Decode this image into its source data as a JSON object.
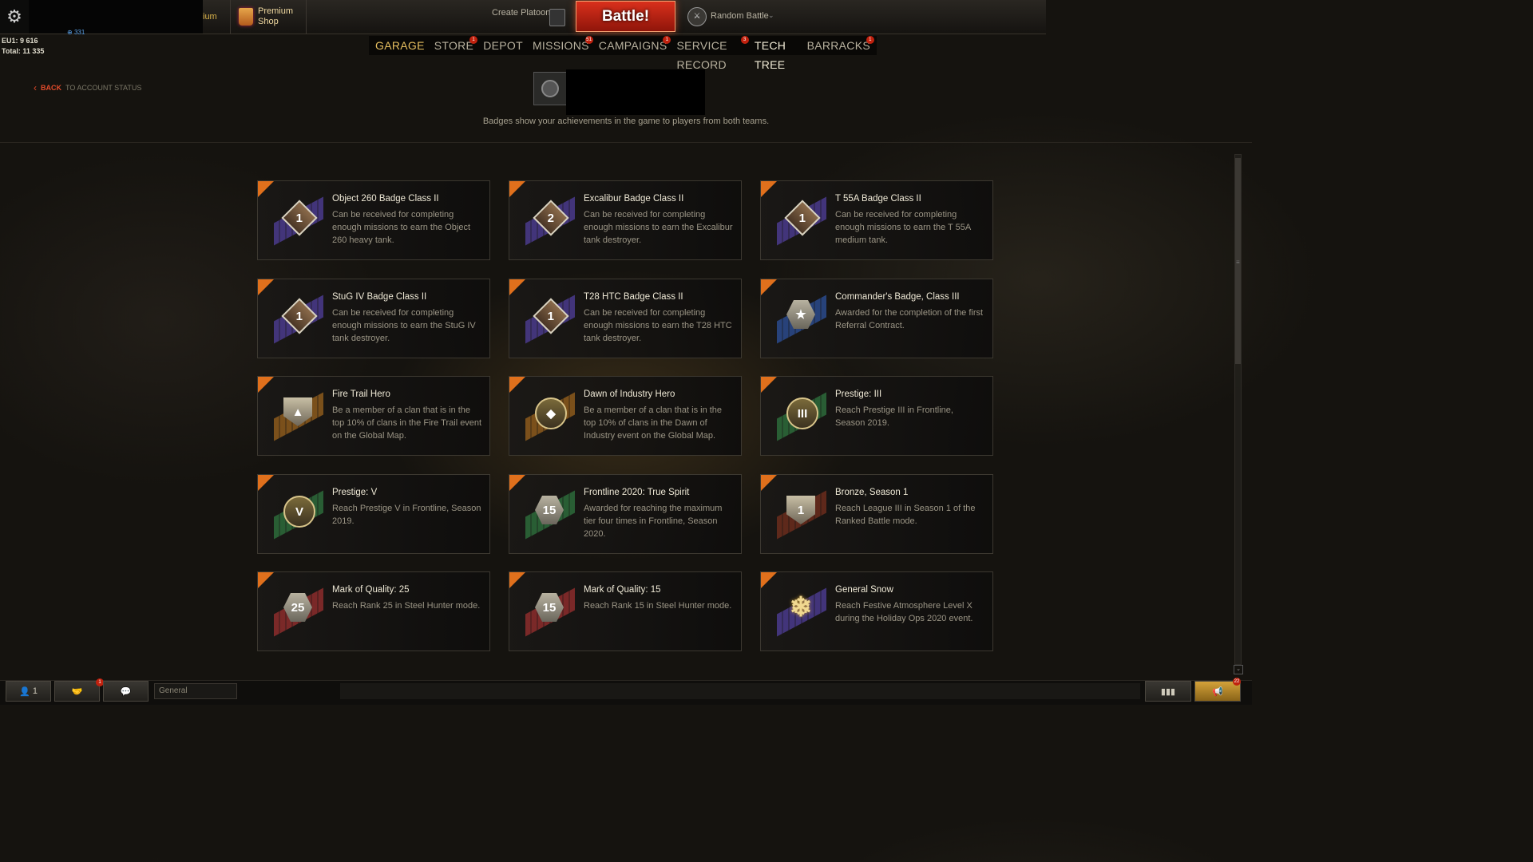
{
  "topbar": {
    "premium_fragment": "ium",
    "premium_shop_label_1": "Premium",
    "premium_shop_label_2": "Shop",
    "create_platoon": "Create Platoon",
    "battle_button": "Battle!",
    "battle_mode": "Random Battle"
  },
  "stats": {
    "line1": "EU1: 9 616",
    "line2": "Total: 11 335",
    "mini_value": "331"
  },
  "nav": [
    {
      "label": "GARAGE",
      "badge": ""
    },
    {
      "label": "STORE",
      "badge": "1"
    },
    {
      "label": "DEPOT",
      "badge": ""
    },
    {
      "label": "MISSIONS",
      "badge": "51"
    },
    {
      "label": "CAMPAIGNS",
      "badge": "1"
    },
    {
      "label": "SERVICE RECORD",
      "badge": "3"
    },
    {
      "label": "TECH TREE",
      "badge": ""
    },
    {
      "label": "BARRACKS",
      "badge": "1"
    }
  ],
  "back": {
    "back_label": "BACK",
    "target_label": "TO ACCOUNT STATUS"
  },
  "header": {
    "subtitle": "Badges show your achievements in the game to players from both teams."
  },
  "colors": {
    "accent_orange": "#e0701c",
    "battle_red": "#c3200f",
    "nav_active": "#e8c060"
  },
  "badges": [
    {
      "title": "Object 260 Badge Class II",
      "desc": "Can be received for completing enough missions to earn the Object 260 heavy tank.",
      "icon": "rank-1-diamond-icon",
      "glyph": "1",
      "stripe": "#4a3a8c"
    },
    {
      "title": "Excalibur Badge Class II",
      "desc": "Can be received for completing enough missions to earn the Excalibur tank destroyer.",
      "icon": "rank-2-diamond-icon",
      "glyph": "2",
      "stripe": "#4a3a8c"
    },
    {
      "title": "T 55A Badge Class II",
      "desc": "Can be received for completing enough missions to earn the T 55A medium tank.",
      "icon": "rank-1-diamond-icon",
      "glyph": "1",
      "stripe": "#4a3a8c"
    },
    {
      "title": "StuG IV Badge Class II",
      "desc": "Can be received for completing enough missions to earn the StuG IV tank destroyer.",
      "icon": "rank-1-diamond-icon",
      "glyph": "1",
      "stripe": "#4a3a8c"
    },
    {
      "title": "T28 HTC Badge Class II",
      "desc": "Can be received for completing enough missions to earn the T28 HTC tank destroyer.",
      "icon": "rank-1-diamond-icon",
      "glyph": "1",
      "stripe": "#4a3a8c"
    },
    {
      "title": "Commander's Badge, Class III",
      "desc": "Awarded for the completion of the first Referral Contract.",
      "icon": "commander-hex-icon",
      "glyph": "★",
      "stripe": "#2a4a8c"
    },
    {
      "title": "Fire Trail Hero",
      "desc": "Be a member of a clan that is in the top 10% of clans in the Fire Trail event on the Global Map.",
      "icon": "fire-trail-shield-icon",
      "glyph": "▲",
      "stripe": "#8c5a1c"
    },
    {
      "title": "Dawn of Industry Hero",
      "desc": "Be a member of a clan that is in the top 10% of clans in the Dawn of Industry event on the Global Map.",
      "icon": "dawn-industry-gear-icon",
      "glyph": "◆",
      "stripe": "#8c5a1c"
    },
    {
      "title": "Prestige: III",
      "desc": "Reach Prestige III in Frontline, Season 2019.",
      "icon": "prestige-3-icon",
      "glyph": "III",
      "stripe": "#2c6a3a"
    },
    {
      "title": "Prestige: V",
      "desc": "Reach Prestige V in Frontline, Season 2019.",
      "icon": "prestige-5-icon",
      "glyph": "V",
      "stripe": "#2c6a3a"
    },
    {
      "title": "Frontline 2020: True Spirit",
      "desc": "Awarded for reaching the maximum tier four times in Frontline, Season 2020.",
      "icon": "frontline-15-icon",
      "glyph": "15",
      "stripe": "#2c6a3a"
    },
    {
      "title": "Bronze, Season 1",
      "desc": "Reach League III in Season 1 of the Ranked Battle mode.",
      "icon": "bronze-league-icon",
      "glyph": "1",
      "stripe": "#6a2c1c"
    },
    {
      "title": "Mark of Quality: 25",
      "desc": "Reach Rank 25 in Steel Hunter mode.",
      "icon": "mark-quality-25-icon",
      "glyph": "25",
      "stripe": "#8c2c2c"
    },
    {
      "title": "Mark of Quality: 15",
      "desc": "Reach Rank 15 in Steel Hunter mode.",
      "icon": "mark-quality-15-icon",
      "glyph": "15",
      "stripe": "#8c2c2c"
    },
    {
      "title": "General Snow",
      "desc": "Reach Festive Atmosphere Level X during the Holiday Ops 2020 event.",
      "icon": "snowflake-icon",
      "glyph": "❄",
      "stripe": "#4a3a8c"
    }
  ],
  "bottombar": {
    "friends_count": "1",
    "clan_badge": "1",
    "channel_name": "General",
    "notifications_badge": "22"
  }
}
